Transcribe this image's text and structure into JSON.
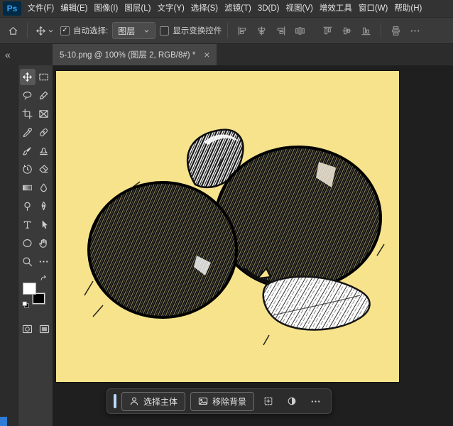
{
  "app": {
    "logo_text": "Ps"
  },
  "menu_bar": {
    "items": [
      "文件(F)",
      "编辑(E)",
      "图像(I)",
      "图层(L)",
      "文字(Y)",
      "选择(S)",
      "滤镜(T)",
      "3D(D)",
      "视图(V)",
      "增效工具",
      "窗口(W)",
      "帮助(H)"
    ]
  },
  "options_bar": {
    "auto_select_label": "自动选择:",
    "auto_select_checked": true,
    "target_dropdown_value": "图层",
    "show_transform_label": "显示变换控件",
    "show_transform_checked": false,
    "align_icons_group1": [
      "align-left-edges",
      "align-horizontal-centers",
      "align-right-edges",
      "distribute-horizontal-centers"
    ],
    "align_icons_group2": [
      "align-top-edges",
      "align-vertical-centers",
      "align-bottom-edges"
    ],
    "align_icons_group3": [
      "distribute-vertical-centers",
      "align-more"
    ]
  },
  "tab_bar": {
    "collapse_glyph": "«",
    "document_title": "5-10.png @ 100% (图层 2, RGB/8#) *",
    "close_glyph": "×"
  },
  "toolbar": {
    "tools": [
      {
        "icon": "move",
        "selected": true
      },
      {
        "icon": "rectangular-marquee"
      },
      {
        "icon": "lasso"
      },
      {
        "icon": "object-selection"
      },
      {
        "icon": "crop"
      },
      {
        "icon": "frame"
      },
      {
        "icon": "eyedropper"
      },
      {
        "icon": "healing-brush"
      },
      {
        "icon": "brush"
      },
      {
        "icon": "clone-stamp"
      },
      {
        "icon": "history-brush"
      },
      {
        "icon": "eraser"
      },
      {
        "icon": "gradient"
      },
      {
        "icon": "blur"
      },
      {
        "icon": "dodge"
      },
      {
        "icon": "pen"
      },
      {
        "icon": "type"
      },
      {
        "icon": "path-selection"
      },
      {
        "icon": "ellipse-shape"
      },
      {
        "icon": "hand"
      },
      {
        "icon": "zoom"
      },
      {
        "icon": "edit-toolbar"
      }
    ],
    "foreground_color": "#ffffff",
    "background_color": "#000000"
  },
  "task_bar": {
    "select_subject_label": "选择主体",
    "remove_background_label": "移除背景"
  },
  "glyphs": {
    "check": "✓"
  },
  "colors": {
    "accent_blue": "#31a8ff",
    "canvas_yellow": "#f6e38c",
    "handle_blue": "#bcd9ff",
    "status_accent": "#2e7cd6"
  }
}
